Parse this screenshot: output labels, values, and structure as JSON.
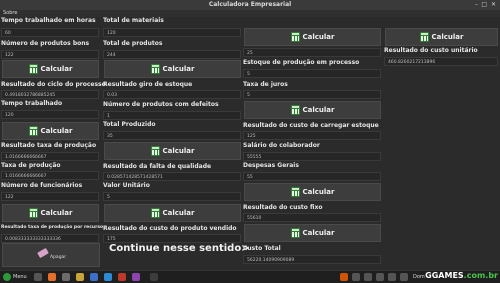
{
  "window": {
    "title": "Calculadora Empresarial"
  },
  "menu": {
    "sobre": "Sobre"
  },
  "calc_label": "Calcular",
  "col1": {
    "tempo_horas_label": "Tempo trabalhado em horas",
    "tempo_horas_value": "60",
    "num_bons_label": "Número de produtos bons",
    "num_bons_value": "122",
    "ciclo_label": "Resultado do ciclo do processo",
    "ciclo_value": "0.4918032786885245",
    "tempo_trab_label": "Tempo trabalhado",
    "tempo_trab_value": "120",
    "taxa_prod_res_label": "Resultado taxa de produção",
    "taxa_prod_res_value": "1.0166666666667",
    "taxa_prod_label": "Taxa de produção",
    "taxa_prod_value": "1.0166666666667",
    "num_func_label": "Número de funcionários",
    "num_func_value": "122",
    "taxa_rec_label": "Resultado taxa de produção por recurso",
    "taxa_rec_value": "0.008333333333333336",
    "apagar_label": "Apagar"
  },
  "col2": {
    "total_mat_label": "Total de materiais",
    "total_mat_value": "120",
    "total_prod_label": "Total de produtos",
    "total_prod_value": "244",
    "giro_label": "Resultado giro de estoque",
    "giro_value": "0.03",
    "defeitos_label": "Número de produtos com defeitos",
    "defeitos_value": "1",
    "produzido_label": "Total Produzido",
    "produzido_value": "35",
    "falta_label": "Resultado da falta de qualidade",
    "falta_value": "0.028571428571428571",
    "valor_label": "Valor Unitário",
    "valor_value": "5",
    "custo_vendido_label": "Resultado do custo do produto vendido",
    "custo_vendido_value": "175",
    "continue": "Continue nesse sentido>"
  },
  "col3": {
    "field_top_value": "25",
    "estoque_label": "Estoque de produção em processo",
    "estoque_value": "5",
    "juros_label": "Taxa de juros",
    "juros_value": "5",
    "carregar_label": "Resultado do custo de carregar estoque",
    "carregar_value": "125",
    "salario_label": "Salário do colaborador",
    "salario_value": "55555",
    "despesas_label": "Despesas Gerais",
    "despesas_value": "55",
    "fixo_label": "Resultado do custo fixo",
    "fixo_value": "55610",
    "custo_total_label": "Custo Total",
    "custo_total_value": "56220.14090909089"
  },
  "col4": {
    "unitario_label": "Resultado do custo unitário",
    "unitario_value": "460.8260217213896"
  },
  "taskbar": {
    "menu": "Menu",
    "lang": "Dom"
  },
  "watermark": {
    "part1": "GGAMES",
    "part2": ".com.br"
  },
  "colors": {
    "bg": "#2b2b2b",
    "calc_icon": "#2f7d32"
  }
}
